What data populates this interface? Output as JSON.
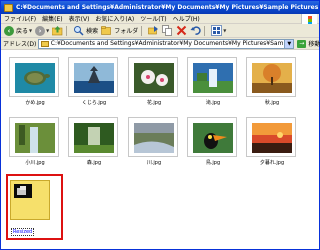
{
  "window": {
    "title": "C:¥Documents and Settings¥Administrator¥My Documents¥My Pictures¥Sample Pictures"
  },
  "menu": {
    "items": [
      "ファイル(F)",
      "編集(E)",
      "表示(V)",
      "お気に入り(A)",
      "ツール(T)",
      "ヘルプ(H)"
    ]
  },
  "toolbar": {
    "back_label": "戻る",
    "search_label": "検索",
    "folders_label": "フォルダ"
  },
  "address": {
    "label": "アドレス(D)",
    "value": "C:¥Documents and Settings¥Administrator¥My Documents¥My Pictures¥Sample Pictures",
    "go_label": "移動"
  },
  "files": [
    {
      "name": "かめ.jpg",
      "icon": "turtle-photo"
    },
    {
      "name": "くじら.jpg",
      "icon": "whale-photo"
    },
    {
      "name": "花.jpg",
      "icon": "flower-photo"
    },
    {
      "name": "滝.jpg",
      "icon": "waterfall-photo"
    },
    {
      "name": "秋.jpg",
      "icon": "autumn-photo"
    },
    {
      "name": "小川.jpg",
      "icon": "stream-photo"
    },
    {
      "name": "森.jpg",
      "icon": "forest-photo"
    },
    {
      "name": "川.jpg",
      "icon": "river-photo"
    },
    {
      "name": "鳥.jpg",
      "icon": "toucan-photo"
    },
    {
      "name": "夕暮れ.jpg",
      "icon": "sunset-photo"
    }
  ],
  "new_folder": {
    "name": "Resized",
    "icon": "folder-icon"
  },
  "colors": {
    "titlebar": "#0a4bd4",
    "highlight": "#dd1111",
    "folder": "#f6e06b"
  }
}
